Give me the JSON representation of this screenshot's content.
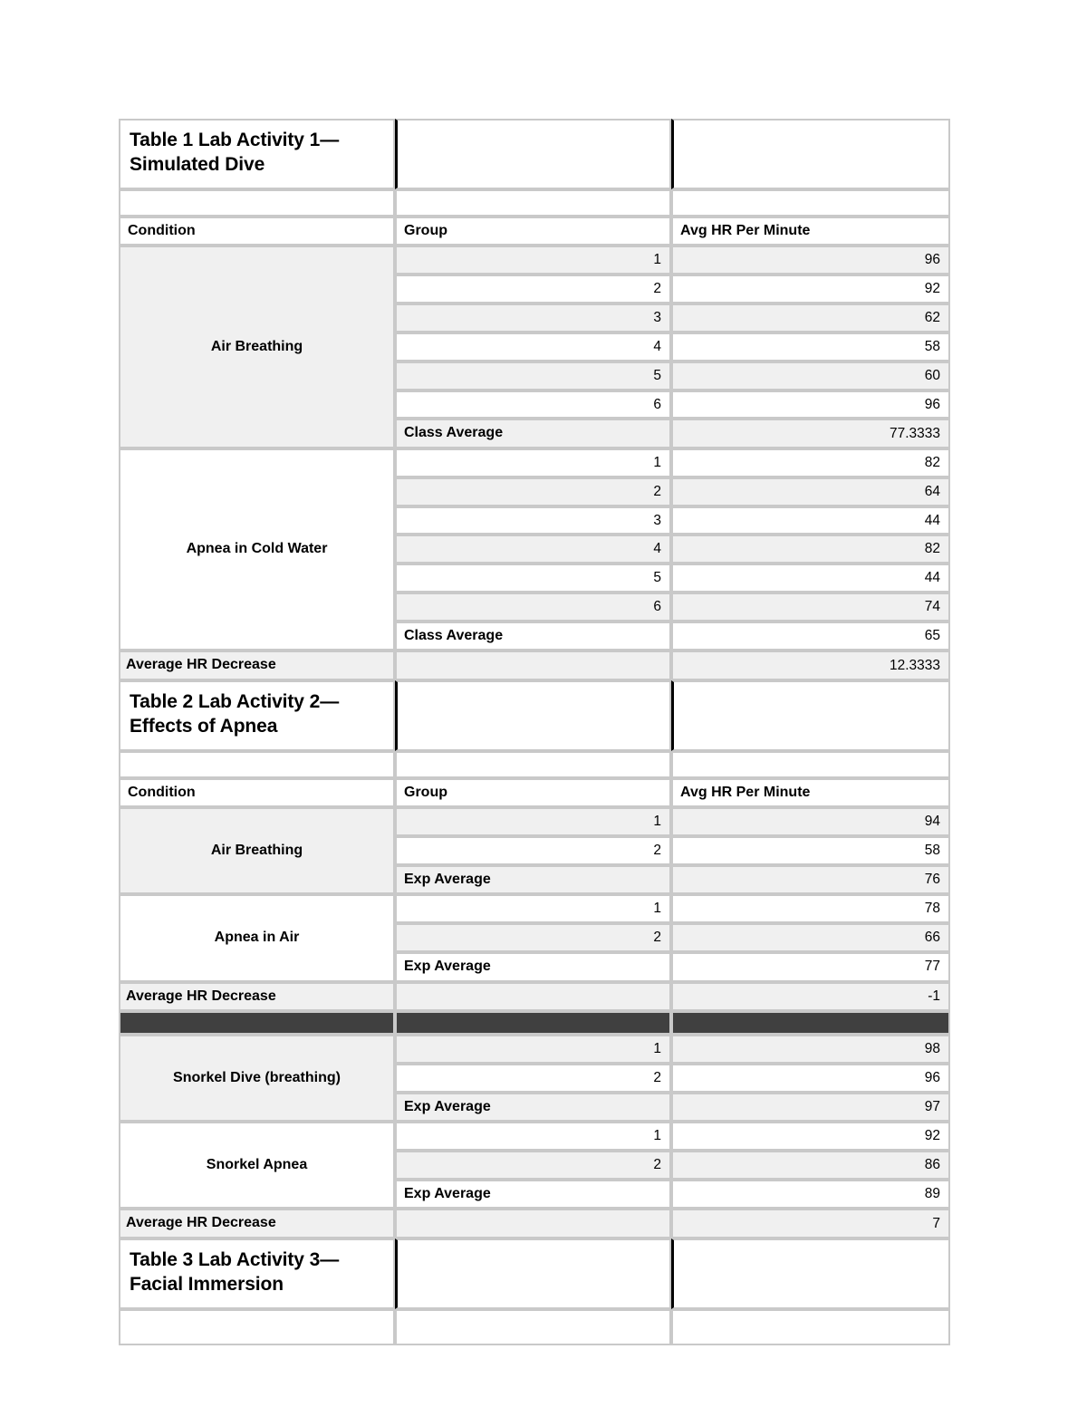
{
  "document": {
    "colors": {
      "shade": "#f0f0f0",
      "border": "#c9c9c9",
      "dark_divider": "#404040",
      "title_divider": "#000000"
    }
  },
  "table1": {
    "title": "Table 1 Lab Activity 1—Simulated Dive",
    "headers": {
      "condition": "Condition",
      "group": "Group",
      "value": "Avg HR Per Minute"
    },
    "sections": [
      {
        "condition": "Air Breathing",
        "rows": [
          {
            "group": "1",
            "value": "96"
          },
          {
            "group": "2",
            "value": "92"
          },
          {
            "group": "3",
            "value": "62"
          },
          {
            "group": "4",
            "value": "58"
          },
          {
            "group": "5",
            "value": "60"
          },
          {
            "group": "6",
            "value": "96"
          }
        ],
        "average_label": "Class Average",
        "average_value": "77.3333"
      },
      {
        "condition": "Apnea in Cold Water",
        "rows": [
          {
            "group": "1",
            "value": "82"
          },
          {
            "group": "2",
            "value": "64"
          },
          {
            "group": "3",
            "value": "44"
          },
          {
            "group": "4",
            "value": "82"
          },
          {
            "group": "5",
            "value": "44"
          },
          {
            "group": "6",
            "value": "74"
          }
        ],
        "average_label": "Class Average",
        "average_value": "65"
      }
    ],
    "footer": {
      "label": "Average HR Decrease",
      "value": "12.3333"
    }
  },
  "table2": {
    "title": "Table 2 Lab Activity 2—Effects of Apnea",
    "headers": {
      "condition": "Condition",
      "group": "Group",
      "value": "Avg HR Per Minute"
    },
    "block_a": {
      "sections": [
        {
          "condition": "Air Breathing",
          "rows": [
            {
              "group": "1",
              "value": "94"
            },
            {
              "group": "2",
              "value": "58"
            }
          ],
          "average_label": "Exp Average",
          "average_value": "76"
        },
        {
          "condition": "Apnea in Air",
          "rows": [
            {
              "group": "1",
              "value": "78"
            },
            {
              "group": "2",
              "value": "66"
            }
          ],
          "average_label": "Exp Average",
          "average_value": "77"
        }
      ],
      "footer": {
        "label": "Average HR Decrease",
        "value": "-1"
      }
    },
    "block_b": {
      "sections": [
        {
          "condition": "Snorkel Dive (breathing)",
          "rows": [
            {
              "group": "1",
              "value": "98"
            },
            {
              "group": "2",
              "value": "96"
            }
          ],
          "average_label": "Exp Average",
          "average_value": "97"
        },
        {
          "condition": "Snorkel Apnea",
          "rows": [
            {
              "group": "1",
              "value": "92"
            },
            {
              "group": "2",
              "value": "86"
            }
          ],
          "average_label": "Exp Average",
          "average_value": "89"
        }
      ],
      "footer": {
        "label": "Average HR Decrease",
        "value": "7"
      }
    }
  },
  "table3": {
    "title": "Table 3 Lab Activity 3—Facial Immersion"
  }
}
